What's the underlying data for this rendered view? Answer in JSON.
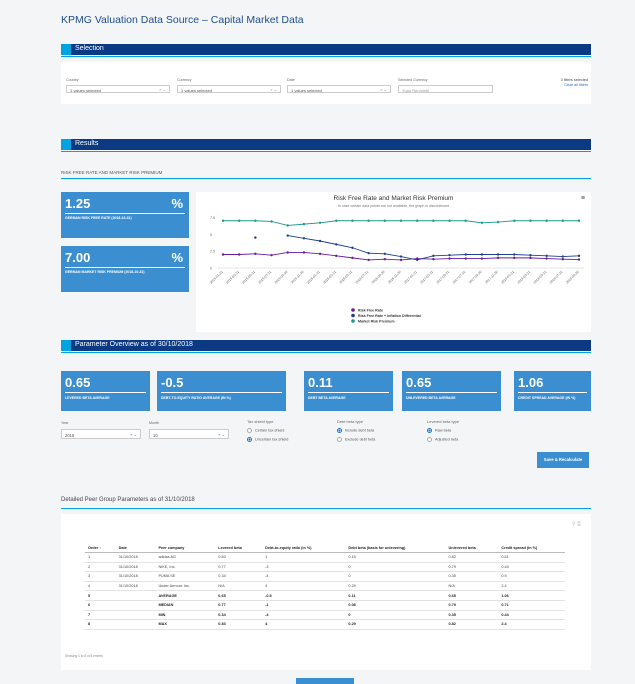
{
  "page_title": "KPMG Valuation Data Source – Capital Market Data",
  "selection": {
    "title": "Selection",
    "country": {
      "label": "Country",
      "value": "1 values selected"
    },
    "currency": {
      "label": "Currency",
      "value": "1 values selected"
    },
    "date": {
      "label": "Date",
      "value": "1 values selected"
    },
    "selected_currency": {
      "label": "Selected Currency",
      "placeholder": "Yuan Renminbi"
    },
    "filters_selected": "3 filters selected",
    "clear_filters": "Clear all filters"
  },
  "results": {
    "title": "Results",
    "subtitle": "RISK FREE RATE AND MARKET RISK PREMIUM"
  },
  "kpis": [
    {
      "value": "1.25",
      "unit": "%",
      "label": "GERMAN RISK FREE RATE (2018-10-31)"
    },
    {
      "value": "7.00",
      "unit": "%",
      "label": "GERMAN MARKET RISK PREMIUM (2018-10-31)"
    }
  ],
  "chart": {
    "title": "Risk Free Rate and Market Risk Premium",
    "subtitle": "In case certain data points are not available, the graph is discontinued",
    "menu_icon": "hamburger-icon"
  },
  "chart_data": {
    "type": "line",
    "title": "Risk Free Rate and Market Risk Premium",
    "x": [
      "2015-01-31",
      "2015-03-31",
      "2015-05-31",
      "2015-07-31",
      "2015-09-30",
      "2015-11-30",
      "2016-01-31",
      "2016-03-31",
      "2016-05-31",
      "2016-07-31",
      "2016-09-30",
      "2016-11-30",
      "2017-01-31",
      "2017-03-31",
      "2017-05-31",
      "2017-07-31",
      "2017-09-30",
      "2017-11-30",
      "2018-01-31",
      "2018-03-31",
      "2018-05-31",
      "2018-07-31",
      "2018-09-30"
    ],
    "xlabels": [
      "2015-01-31",
      "2015-03-31",
      "2015-05-31",
      "2015-07-31",
      "2015-09-30",
      "2015-11-30",
      "2016-01-31",
      "2016-03-31",
      "2016-05-31",
      "2016-07-31",
      "2016-09-30",
      "2016-11-30",
      "2017-01-31",
      "2017-03-31",
      "2017-05-31",
      "2017-07-31",
      "2017-09-30",
      "2017-11-30",
      "2018-01-31",
      "2018-03-31",
      "2018-05-31",
      "2018-07-31",
      "2018-09-30"
    ],
    "yticks": [
      "7.5",
      "5",
      "2.5",
      "0"
    ],
    "ylim": [
      0,
      8
    ],
    "series": [
      {
        "name": "Risk Free Rate",
        "color": "#6a1b9a",
        "values": [
          2.0,
          2.0,
          2.1,
          1.9,
          2.3,
          2.3,
          2.1,
          1.8,
          1.5,
          1.2,
          1.3,
          1.2,
          1.4,
          1.3,
          1.4,
          1.4,
          1.4,
          1.5,
          1.5,
          1.5,
          1.4,
          1.3,
          1.25
        ]
      },
      {
        "name": "Risk Free Rate + Inflation Differential",
        "color": "#1f3f8f",
        "values": [
          null,
          null,
          4.5,
          null,
          4.8,
          4.4,
          4.0,
          3.5,
          3.0,
          2.2,
          2.1,
          1.7,
          1.2,
          1.8,
          1.9,
          2.0,
          2.0,
          2.0,
          2.0,
          1.9,
          1.8,
          1.7,
          1.8
        ]
      },
      {
        "name": "Market Risk Premium",
        "color": "#1b9a8a",
        "values": [
          7.0,
          7.0,
          7.0,
          6.9,
          6.3,
          6.5,
          6.7,
          7.0,
          7.0,
          7.0,
          7.0,
          7.0,
          7.0,
          7.0,
          7.0,
          7.0,
          6.7,
          6.8,
          7.0,
          7.0,
          7.0,
          7.0,
          7.0
        ]
      }
    ]
  },
  "overview": {
    "title": "Parameter Overview as of 30/10/2018",
    "cards": [
      {
        "value": "0.65",
        "label": "LEVERED BETA AVERAGE"
      },
      {
        "value": "-0.5",
        "label": "DEBT-TO-EQUITY RATIO AVERAGE (IN %)"
      },
      {
        "value": "0.11",
        "label": "DEBT BETA AVERAGE"
      },
      {
        "value": "0.65",
        "label": "UNLEVERED BETA AVERAGE"
      },
      {
        "value": "1.06",
        "label": "CREDIT SPREAD AVERAGE (IN %)"
      }
    ]
  },
  "controls": {
    "year_label": "Year",
    "year_value": "2018",
    "month_label": "Month",
    "month_value": "10",
    "tax_label": "Tax shield type",
    "tax_opt1": "Certain tax shield",
    "tax_opt2": "Uncertain tax shield",
    "debt_label": "Debt beta type",
    "debt_opt1": "Include debt beta",
    "debt_opt2": "Exclude debt beta",
    "lev_label": "Levered beta type",
    "lev_opt1": "Raw beta",
    "lev_opt2": "Adjusted beta",
    "save_button": "Save & Recalculate"
  },
  "peer": {
    "title": "Detailed Peer Group Parameters as of 31/10/2018",
    "columns": [
      "Order ↑",
      "Date",
      "Peer company",
      "Levered beta",
      "Debt-to-equity ratio (in %)",
      "Debt beta (basis for unlevering)",
      "Unlevered beta",
      "Credit spread (in %)"
    ],
    "rows": [
      [
        "1",
        "31/10/2018",
        "adidas AG",
        "0.83",
        "1",
        "0.15",
        "0.82",
        "0.51"
      ],
      [
        "2",
        "31/10/2018",
        "NIKE, Inc.",
        "0.77",
        "-3",
        "0",
        "0.79",
        "0.44"
      ],
      [
        "3",
        "31/10/2018",
        "PUMA SE",
        "0.34",
        "-4",
        "0",
        "0.35",
        "0.9"
      ],
      [
        "4",
        "31/10/2018",
        "Under Armour, Inc.",
        "N/A",
        "4",
        "0.29",
        "N/A",
        "2.4"
      ]
    ],
    "summary": [
      [
        "5",
        "",
        "AVERAGE",
        "0.65",
        "-0.5",
        "0.11",
        "0.65",
        "1.06"
      ],
      [
        "6",
        "",
        "MEDIAN",
        "0.77",
        "-1",
        "0.08",
        "0.79",
        "0.71"
      ],
      [
        "7",
        "",
        "MIN",
        "0.34",
        "-4",
        "0",
        "0.35",
        "0.44"
      ],
      [
        "8",
        "",
        "MAX",
        "0.83",
        "4",
        "0.29",
        "0.82",
        "2.4"
      ]
    ],
    "footer": "Showing 1 to 8 of 8 entries"
  }
}
